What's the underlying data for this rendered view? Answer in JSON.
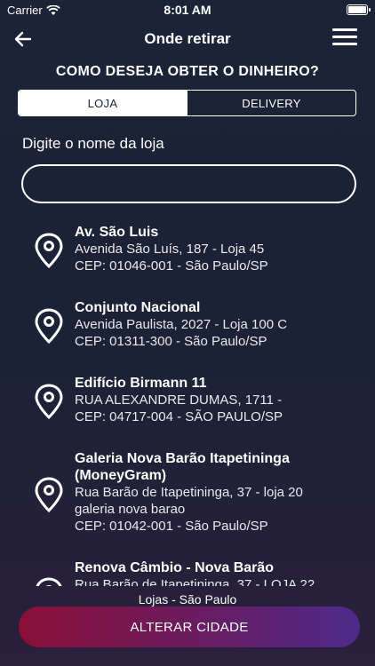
{
  "status_bar": {
    "carrier": "Carrier",
    "time": "8:01 AM"
  },
  "nav": {
    "title": "Onde retirar"
  },
  "question": "COMO DESEJA OBTER O DINHEIRO?",
  "tabs": [
    {
      "label": "LOJA",
      "active": true
    },
    {
      "label": "DELIVERY",
      "active": false
    }
  ],
  "search": {
    "label": "Digite o nome da loja",
    "value": "",
    "placeholder": ""
  },
  "stores": [
    {
      "name": "Av. São Luis",
      "lines": [
        "Avenida São Luís, 187 - Loja 45",
        "CEP: 01046-001 - São Paulo/SP"
      ]
    },
    {
      "name": "Conjunto Nacional",
      "lines": [
        "Avenida Paulista, 2027 - Loja 100 C",
        "CEP: 01311-300 - São Paulo/SP"
      ]
    },
    {
      "name": "Edifício Birmann 11",
      "lines": [
        "RUA ALEXANDRE DUMAS, 1711 -",
        "CEP: 04717-004 - SÃO PAULO/SP"
      ]
    },
    {
      "name": "Galeria Nova Barão Itapetininga",
      "name2": "(MoneyGram)",
      "lines": [
        "Rua Barão de Itapetininga, 37 - loja 20",
        "galeria nova barao",
        "CEP: 01042-001 - São Paulo/SP"
      ]
    },
    {
      "name": "Renova Câmbio - Nova Barão",
      "lines": [
        "Rua Barão de Itapetininga, 37 - LOJA 22"
      ]
    }
  ],
  "footer": {
    "city_label": "Lojas - São Paulo",
    "change_city_label": "ALTERAR CIDADE"
  },
  "colors": {
    "background": "#1b2336",
    "button_start": "#8a1038",
    "button_end": "#4d2a8a"
  }
}
